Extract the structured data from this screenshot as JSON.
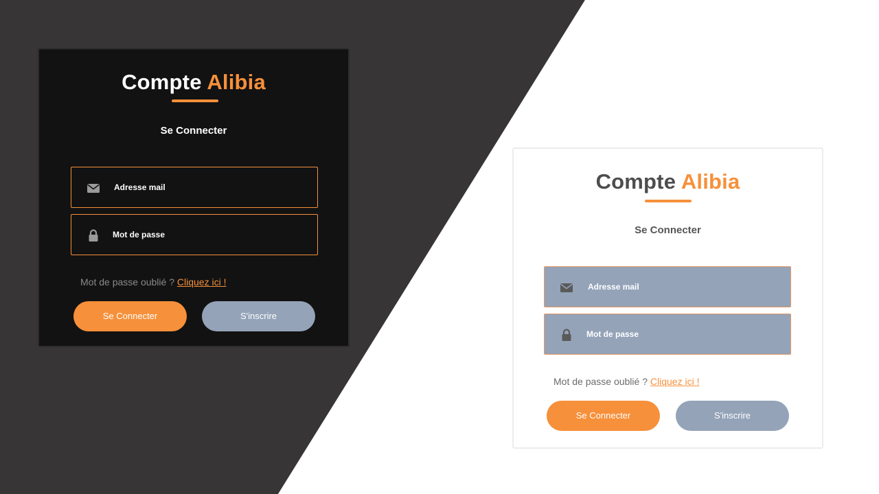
{
  "colors": {
    "accent": "#f6903a",
    "dark_background": "#373536",
    "dark_card": "#121212",
    "light_background": "#ffffff",
    "secondary_button": "#94a3b8"
  },
  "dark_card": {
    "title_main": "Compte",
    "title_accent": "Alibia",
    "subtitle": "Se Connecter",
    "email_field": {
      "label": "Adresse mail",
      "icon": "envelope-icon"
    },
    "password_field": {
      "label": "Mot de passe",
      "icon": "lock-icon"
    },
    "forgot_text": "Mot de passe oublié ?",
    "forgot_link": "Cliquez ici !",
    "login_button": "Se Connecter",
    "signup_button": "S'inscrire"
  },
  "light_card": {
    "title_main": "Compte",
    "title_accent": "Alibia",
    "subtitle": "Se Connecter",
    "email_field": {
      "label": "Adresse mail",
      "icon": "envelope-icon"
    },
    "password_field": {
      "label": "Mot de passe",
      "icon": "lock-icon"
    },
    "forgot_text": "Mot de passe oublié ?",
    "forgot_link": "Cliquez ici !",
    "login_button": "Se Connecter",
    "signup_button": "S'inscrire"
  }
}
